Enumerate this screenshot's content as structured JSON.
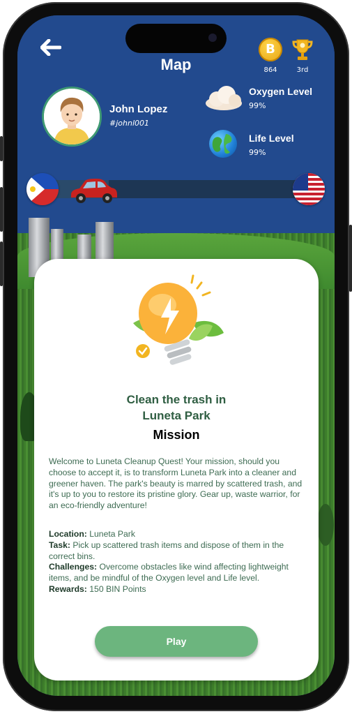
{
  "header": {
    "title": "Map",
    "coin_symbol": "B",
    "coins": "864",
    "rank": "3rd"
  },
  "user": {
    "name": "John Lopez",
    "handle": "#johnl001"
  },
  "stats": {
    "oxygen_label": "Oxygen Level",
    "oxygen_value": "99%",
    "life_label": "Life Level",
    "life_value": "99%"
  },
  "journey": {
    "progress": 0.25
  },
  "mission": {
    "title_line1": "Clean the trash in",
    "title_line2": "Luneta Park",
    "subtitle": "Mission",
    "description": "Welcome to Luneta Cleanup Quest! Your mission, should you choose to accept it, is to transform Luneta Park into a cleaner and greener haven. The park's beauty is marred by scattered trash, and it's up to you to restore its pristine glory. Gear up, waste warrior, for an eco-friendly adventure!",
    "location_label": "Location:",
    "location": "Luneta Park",
    "task_label": "Task:",
    "task": "Pick up scattered trash items and dispose of them in the correct bins.",
    "challenges_label": "Challenges:",
    "challenges": "Overcome obstacles like wind affecting lightweight items, and be mindful of the Oxygen level and Life level.",
    "rewards_label": "Rewards:",
    "rewards": "150 BIN Points",
    "play_label": "Play"
  },
  "colors": {
    "sky": "#224a8e",
    "accent_green": "#6cb57e",
    "title_green": "#2f5e42"
  }
}
